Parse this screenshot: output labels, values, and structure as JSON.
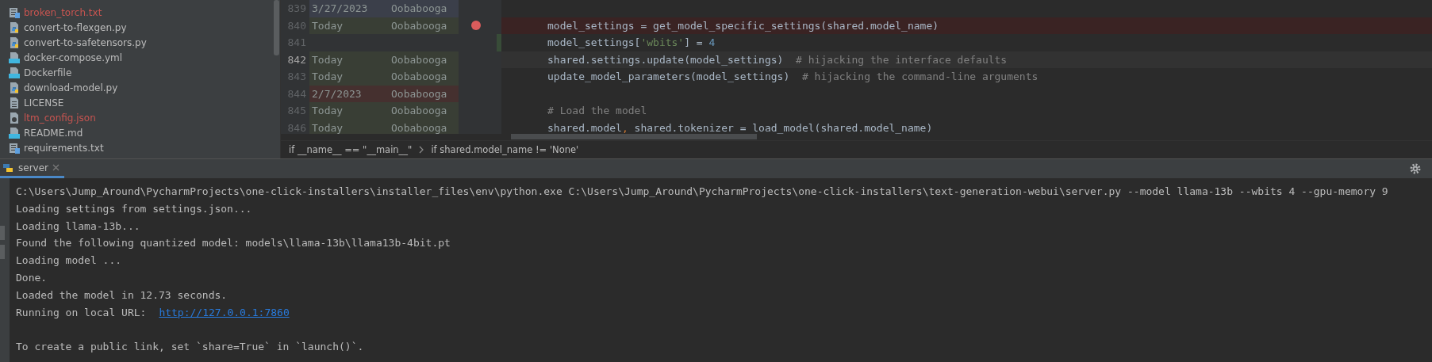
{
  "project_tree": {
    "files": [
      {
        "name": "broken_torch.txt",
        "kind": "text",
        "color": "#c75450"
      },
      {
        "name": "convert-to-flexgen.py",
        "kind": "python",
        "color": "#bbbbbb"
      },
      {
        "name": "convert-to-safetensors.py",
        "kind": "python",
        "color": "#bbbbbb"
      },
      {
        "name": "docker-compose.yml",
        "kind": "compose",
        "color": "#bbbbbb"
      },
      {
        "name": "Dockerfile",
        "kind": "docker",
        "color": "#bbbbbb"
      },
      {
        "name": "download-model.py",
        "kind": "python",
        "color": "#bbbbbb"
      },
      {
        "name": "LICENSE",
        "kind": "plain",
        "color": "#bbbbbb"
      },
      {
        "name": "ltm_config.json",
        "kind": "json",
        "color": "#c75450"
      },
      {
        "name": "README.md",
        "kind": "markdown",
        "color": "#bbbbbb"
      },
      {
        "name": "requirements.txt",
        "kind": "text",
        "color": "#bbbbbb"
      }
    ]
  },
  "editor": {
    "lines": [
      {
        "number": "839",
        "date": "3/27/2023",
        "author": "Oobabooga",
        "color": "#3b3f4a",
        "breakpoint": false,
        "changed": false,
        "current": false
      },
      {
        "number": "840",
        "date": "Today",
        "author": "Oobabooga",
        "color": "#393e35",
        "breakpoint": true,
        "changed": false,
        "current": false,
        "code": [
          {
            "text": "model_settings = get_model_specific_settings(shared.model_name)",
            "kind": "plain"
          }
        ]
      },
      {
        "number": "841",
        "breakpoint": false,
        "changed": true,
        "current": false,
        "code": [
          {
            "text": "model_settings[",
            "kind": "plain"
          },
          {
            "text": "'wbits'",
            "kind": "string"
          },
          {
            "text": "] = ",
            "kind": "plain"
          },
          {
            "text": "4",
            "kind": "number"
          }
        ]
      },
      {
        "number": "842",
        "date": "Today",
        "author": "Oobabooga",
        "color": "#393e35",
        "breakpoint": false,
        "changed": false,
        "current": true,
        "code": [
          {
            "text": "shared.settings.update(model_settings)  ",
            "kind": "plain"
          },
          {
            "text": "# hijacking the interface defaults",
            "kind": "comment"
          }
        ]
      },
      {
        "number": "843",
        "date": "Today",
        "author": "Oobabooga",
        "color": "#393e35",
        "breakpoint": false,
        "changed": false,
        "current": false,
        "code": [
          {
            "text": "update_model_parameters(model_settings)  ",
            "kind": "plain"
          },
          {
            "text": "# hijacking the command-line arguments",
            "kind": "comment"
          }
        ]
      },
      {
        "number": "844",
        "date": "2/7/2023",
        "author": "Oobabooga",
        "color": "#45302f",
        "breakpoint": false,
        "changed": false,
        "current": false
      },
      {
        "number": "845",
        "date": "Today",
        "author": "Oobabooga",
        "color": "#393e35",
        "breakpoint": false,
        "changed": false,
        "current": false,
        "code": [
          {
            "text": "# Load the model",
            "kind": "comment"
          }
        ]
      },
      {
        "number": "846",
        "date": "Today",
        "author": "Oobabooga",
        "color": "#393e35",
        "breakpoint": false,
        "changed": false,
        "current": false,
        "code": [
          {
            "text": "shared.model",
            "kind": "plain"
          },
          {
            "text": ",",
            "kind": "keyword"
          },
          {
            "text": " shared.tokenizer = load_model(shared.model_name)",
            "kind": "plain"
          }
        ]
      }
    ],
    "breadcrumbs": [
      "if __name__ == \"__main__\"",
      "if shared.model_name != 'None'"
    ]
  },
  "run_panel": {
    "tab": "server",
    "lines": [
      {
        "segments": [
          {
            "text": "C:\\Users\\Jump_Around\\PycharmProjects\\one-click-installers\\installer_files\\env\\python.exe C:\\Users\\Jump_Around\\PycharmProjects\\one-click-installers\\text-generation-webui\\server.py --model llama-13b --wbits 4 --gpu-memory 9",
            "kind": "plain"
          }
        ]
      },
      {
        "segments": [
          {
            "text": "Loading settings from settings.json...",
            "kind": "plain"
          }
        ]
      },
      {
        "segments": [
          {
            "text": "Loading llama-13b...",
            "kind": "plain"
          }
        ]
      },
      {
        "segments": [
          {
            "text": "Found the following quantized model: models\\llama-13b\\llama13b-4bit.pt",
            "kind": "plain"
          }
        ]
      },
      {
        "segments": [
          {
            "text": "Loading model ...",
            "kind": "plain"
          }
        ]
      },
      {
        "segments": [
          {
            "text": "Done.",
            "kind": "plain"
          }
        ]
      },
      {
        "segments": [
          {
            "text": "Loaded the model in 12.73 seconds.",
            "kind": "plain"
          }
        ]
      },
      {
        "segments": [
          {
            "text": "Running on local URL:",
            "kind": "plain"
          },
          {
            "text": "http://127.0.0.1:7860",
            "kind": "link"
          }
        ]
      },
      {
        "blank_line_before": true,
        "segments": [
          {
            "text": "To create a public link, set `share=True` in `launch()`.",
            "kind": "plain"
          }
        ]
      }
    ]
  }
}
